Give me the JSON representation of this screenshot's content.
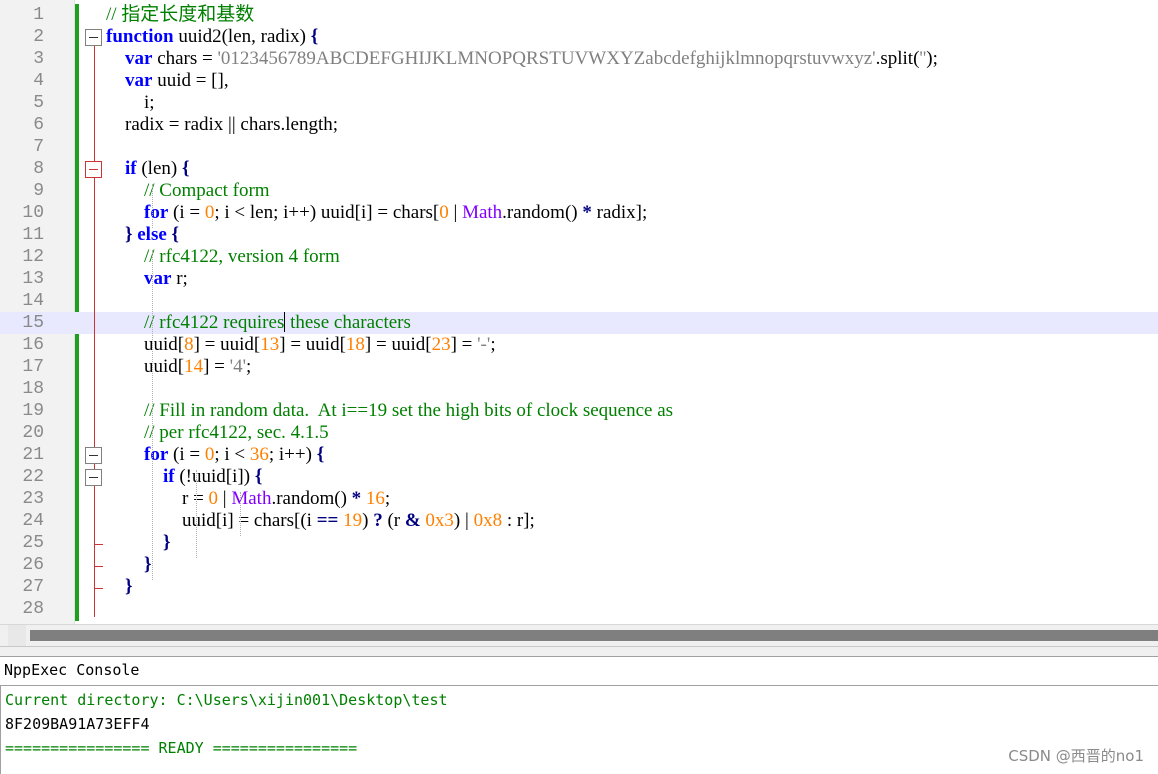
{
  "editor": {
    "lines": [
      {
        "n": "1",
        "tokens": [
          {
            "t": "// 指定长度和基数",
            "c": "cm"
          }
        ]
      },
      {
        "n": "2",
        "tokens": [
          {
            "t": "function",
            "c": "kw"
          },
          {
            "t": " uuid2(len, radix) "
          },
          {
            "t": "{",
            "c": "op"
          }
        ]
      },
      {
        "n": "3",
        "tokens": [
          {
            "t": "    "
          },
          {
            "t": "var",
            "c": "kw"
          },
          {
            "t": " chars = "
          },
          {
            "t": "'0123456789ABCDEFGHIJKLMNOPQRSTUVWXYZabcdefghijklmnopqrstuvwxyz'",
            "c": "st"
          },
          {
            "t": ".split("
          },
          {
            "t": "''",
            "c": "st"
          },
          {
            "t": ");"
          }
        ]
      },
      {
        "n": "4",
        "tokens": [
          {
            "t": "    "
          },
          {
            "t": "var",
            "c": "kw"
          },
          {
            "t": " uuid = [],"
          }
        ]
      },
      {
        "n": "5",
        "tokens": [
          {
            "t": "        i;"
          }
        ]
      },
      {
        "n": "6",
        "tokens": [
          {
            "t": "    radix = radix || chars.length;"
          }
        ]
      },
      {
        "n": "7",
        "tokens": []
      },
      {
        "n": "8",
        "tokens": [
          {
            "t": "    "
          },
          {
            "t": "if",
            "c": "kw"
          },
          {
            "t": " (len) "
          },
          {
            "t": "{",
            "c": "op"
          }
        ]
      },
      {
        "n": "9",
        "tokens": [
          {
            "t": "        "
          },
          {
            "t": "// Compact form",
            "c": "cm"
          }
        ]
      },
      {
        "n": "10",
        "tokens": [
          {
            "t": "        "
          },
          {
            "t": "for",
            "c": "kw"
          },
          {
            "t": " (i = "
          },
          {
            "t": "0",
            "c": "nm"
          },
          {
            "t": "; i < len; i++) uuid[i] = chars["
          },
          {
            "t": "0",
            "c": "nm"
          },
          {
            "t": " | "
          },
          {
            "t": "Math",
            "c": "ob"
          },
          {
            "t": ".random() "
          },
          {
            "t": "*",
            "c": "op"
          },
          {
            "t": " radix];"
          }
        ]
      },
      {
        "n": "11",
        "tokens": [
          {
            "t": "    "
          },
          {
            "t": "}",
            "c": "op"
          },
          {
            "t": " "
          },
          {
            "t": "else",
            "c": "kw"
          },
          {
            "t": " "
          },
          {
            "t": "{",
            "c": "op"
          }
        ]
      },
      {
        "n": "12",
        "tokens": [
          {
            "t": "        "
          },
          {
            "t": "// rfc4122, version 4 form",
            "c": "cm"
          }
        ]
      },
      {
        "n": "13",
        "tokens": [
          {
            "t": "        "
          },
          {
            "t": "var",
            "c": "kw"
          },
          {
            "t": " r;"
          }
        ]
      },
      {
        "n": "14",
        "tokens": []
      },
      {
        "n": "15",
        "tokens": [
          {
            "t": "        "
          },
          {
            "t": "// rfc4122 requires",
            "c": "cm"
          },
          {
            "t": "|CARET|"
          },
          {
            "t": " these characters",
            "c": "cm"
          }
        ]
      },
      {
        "n": "16",
        "tokens": [
          {
            "t": "        uuid["
          },
          {
            "t": "8",
            "c": "nm"
          },
          {
            "t": "] = uuid["
          },
          {
            "t": "13",
            "c": "nm"
          },
          {
            "t": "] = uuid["
          },
          {
            "t": "18",
            "c": "nm"
          },
          {
            "t": "] = uuid["
          },
          {
            "t": "23",
            "c": "nm"
          },
          {
            "t": "] = "
          },
          {
            "t": "'-'",
            "c": "st"
          },
          {
            "t": ";"
          }
        ]
      },
      {
        "n": "17",
        "tokens": [
          {
            "t": "        uuid["
          },
          {
            "t": "14",
            "c": "nm"
          },
          {
            "t": "] = "
          },
          {
            "t": "'4'",
            "c": "st"
          },
          {
            "t": ";"
          }
        ]
      },
      {
        "n": "18",
        "tokens": []
      },
      {
        "n": "19",
        "tokens": [
          {
            "t": "        "
          },
          {
            "t": "// Fill in random data.  At i==19 set the high bits of clock sequence as",
            "c": "cm"
          }
        ]
      },
      {
        "n": "20",
        "tokens": [
          {
            "t": "        "
          },
          {
            "t": "// per rfc4122, sec. 4.1.5",
            "c": "cm"
          }
        ]
      },
      {
        "n": "21",
        "tokens": [
          {
            "t": "        "
          },
          {
            "t": "for",
            "c": "kw"
          },
          {
            "t": " (i = "
          },
          {
            "t": "0",
            "c": "nm"
          },
          {
            "t": "; i < "
          },
          {
            "t": "36",
            "c": "nm"
          },
          {
            "t": "; i++) "
          },
          {
            "t": "{",
            "c": "op"
          }
        ]
      },
      {
        "n": "22",
        "tokens": [
          {
            "t": "            "
          },
          {
            "t": "if",
            "c": "kw"
          },
          {
            "t": " (!uuid[i]) "
          },
          {
            "t": "{",
            "c": "op"
          }
        ]
      },
      {
        "n": "23",
        "tokens": [
          {
            "t": "                r = "
          },
          {
            "t": "0",
            "c": "nm"
          },
          {
            "t": " | "
          },
          {
            "t": "Math",
            "c": "ob"
          },
          {
            "t": ".random() "
          },
          {
            "t": "*",
            "c": "op"
          },
          {
            "t": " "
          },
          {
            "t": "16",
            "c": "nm"
          },
          {
            "t": ";"
          }
        ]
      },
      {
        "n": "24",
        "tokens": [
          {
            "t": "                uuid[i] = chars[(i "
          },
          {
            "t": "==",
            "c": "op"
          },
          {
            "t": " "
          },
          {
            "t": "19",
            "c": "nm"
          },
          {
            "t": ") "
          },
          {
            "t": "?",
            "c": "op"
          },
          {
            "t": " (r "
          },
          {
            "t": "&",
            "c": "op"
          },
          {
            "t": " "
          },
          {
            "t": "0x3",
            "c": "nm"
          },
          {
            "t": ") | "
          },
          {
            "t": "0x8",
            "c": "nm"
          },
          {
            "t": " : r];"
          }
        ]
      },
      {
        "n": "25",
        "tokens": [
          {
            "t": "            "
          },
          {
            "t": "}",
            "c": "op"
          }
        ]
      },
      {
        "n": "26",
        "tokens": [
          {
            "t": "        "
          },
          {
            "t": "}",
            "c": "op"
          }
        ]
      },
      {
        "n": "27",
        "tokens": [
          {
            "t": "    "
          },
          {
            "t": "}",
            "c": "op"
          }
        ]
      },
      {
        "n": "28",
        "tokens": []
      }
    ],
    "current_line": "15"
  },
  "console": {
    "title": "NppExec Console",
    "lines": [
      {
        "text": "Current directory: C:\\Users\\xijin001\\Desktop\\test",
        "color": "green"
      },
      {
        "text": "8F209BA91A73EFF4",
        "color": "black"
      },
      {
        "text": "================ READY ================",
        "color": "green"
      }
    ]
  },
  "watermark": "CSDN @西晋的no1"
}
